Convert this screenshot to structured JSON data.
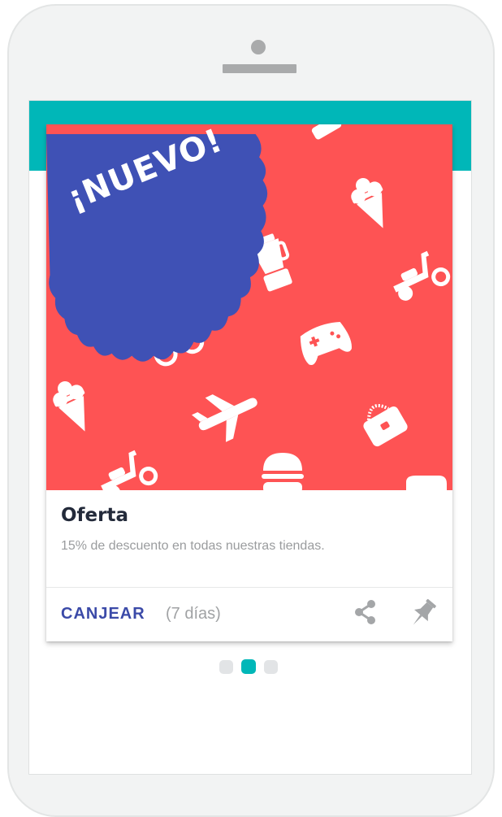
{
  "colors": {
    "accent_teal": "#00b7b8",
    "hero_red": "#fe5354",
    "badge_blue": "#3f51b5",
    "action_blue": "#3b4aa8"
  },
  "card": {
    "badge_text": "¡NUEVO!",
    "title": "Oferta",
    "description": "15% de descuento en todas nuestras tiendas.",
    "redeem_label": "CANJEAR",
    "days_label": "(7 días)",
    "actions": [
      "share-icon",
      "pin-icon"
    ]
  },
  "pagination": {
    "count": 3,
    "active_index": 1
  }
}
